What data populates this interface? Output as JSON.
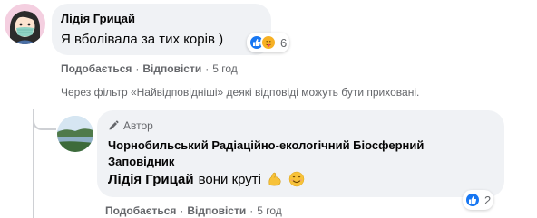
{
  "comment": {
    "author": "Лідія Грицай",
    "text": "Я вболівала за тих корів )",
    "reaction_count": "6",
    "actions": {
      "like": "Подобається",
      "reply": "Відповісти",
      "time": "5 год"
    }
  },
  "filter_note": "Через фільтр «Найвідповідніші» деякі відповіді можуть бути приховані.",
  "reply": {
    "badge": "Автор",
    "author": "Чорнобильський Радіаційно-екологічний Біосферний Заповідник",
    "mention": "Лідія Грицай",
    "text": "вони круті",
    "reaction_count": "2",
    "actions": {
      "like": "Подобається",
      "reply": "Відповісти",
      "time": "5 год"
    }
  },
  "separator": "·",
  "colors": {
    "bubble": "#f0f2f5",
    "secondary_text": "#65676b",
    "like_blue": "#1877f2",
    "care_yellow": "#f7b125"
  }
}
